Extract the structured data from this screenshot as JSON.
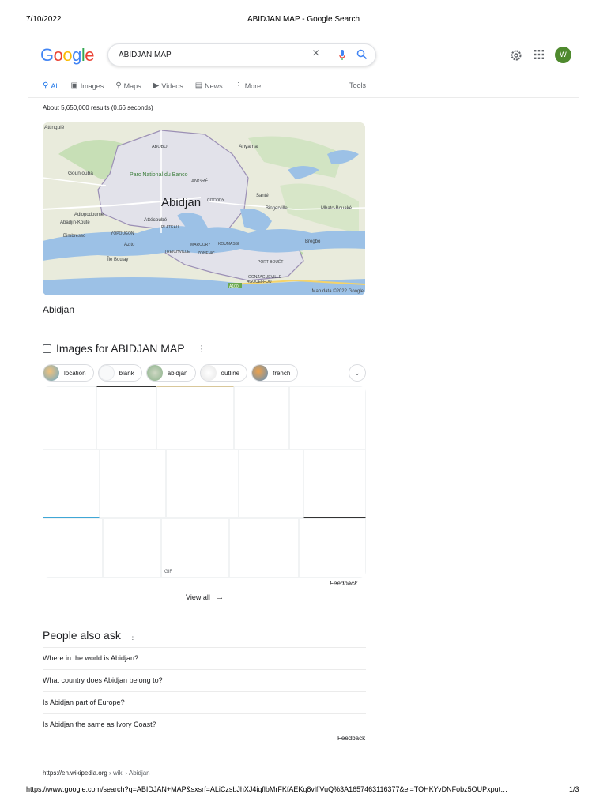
{
  "print": {
    "date": "7/10/2022",
    "title": "ABIDJAN MAP - Google Search",
    "url": "https://www.google.com/search?q=ABIDJAN+MAP&sxsrf=ALiCzsbJhXJ4iqflbMrFKfAEKq8vlfiVuQ%3A1657463116377&ei=TOHKYvDNFobz5OUPxput…",
    "page": "1/3"
  },
  "logo": {
    "letters": [
      "G",
      "o",
      "o",
      "g",
      "l",
      "e"
    ],
    "colors": [
      "#4285f4",
      "#ea4335",
      "#fbbc05",
      "#4285f4",
      "#34a853",
      "#ea4335"
    ]
  },
  "search": {
    "query": "ABIDJAN MAP"
  },
  "header": {
    "avatar_letter": "W",
    "avatar_color": "#4f8a2e"
  },
  "tabs": [
    {
      "icon": "search-icon",
      "label": "All",
      "active": true
    },
    {
      "icon": "image-icon",
      "label": "Images"
    },
    {
      "icon": "map-pin-icon",
      "label": "Maps"
    },
    {
      "icon": "video-icon",
      "label": "Videos"
    },
    {
      "icon": "news-icon",
      "label": "News"
    },
    {
      "icon": "more-icon",
      "label": "More"
    }
  ],
  "tools_label": "Tools",
  "result_stats": "About 5,650,000 results (0.66 seconds)",
  "map": {
    "labels": [
      "Attinguié",
      "ABOBO",
      "Anyama",
      "Gouniouba",
      "Parc National du Banco",
      "ANGRÉ",
      "Abidjan",
      "COCODY",
      "Santé",
      "Bingerville",
      "Mbato-Bouaké",
      "Adiopodoumé",
      "Abadjin-Kouté",
      "Attécoubé",
      "PLATEAU",
      "Bimbresso",
      "YOPOUGON",
      "Azito",
      "MARCORY",
      "KOUMASSI",
      "Brégbo",
      "TREICHVILLE",
      "ZONE 4C",
      "Île Boulay",
      "PORT-BOUËT",
      "GONZAGUEVILLE",
      "AGOUEFFOU",
      "A100"
    ],
    "credit": "Map data ©2022 Google"
  },
  "map_title": "Abidjan",
  "images": {
    "header": "Images for ABIDJAN MAP",
    "chips": [
      "location",
      "blank",
      "abidjan",
      "outline",
      "french"
    ],
    "gif_label": "GIF",
    "feedback": "Feedback",
    "view_all": "View all"
  },
  "paa": {
    "title": "People also ask",
    "questions": [
      "Where in the world is Abidjan?",
      "What country does Abidjan belong to?",
      "Is Abidjan part of Europe?",
      "Is Abidjan the same as Ivory Coast?"
    ],
    "feedback": "Feedback"
  },
  "cite": {
    "domain": "https://en.wikipedia.org",
    "path": " › wiki › Abidjan"
  }
}
